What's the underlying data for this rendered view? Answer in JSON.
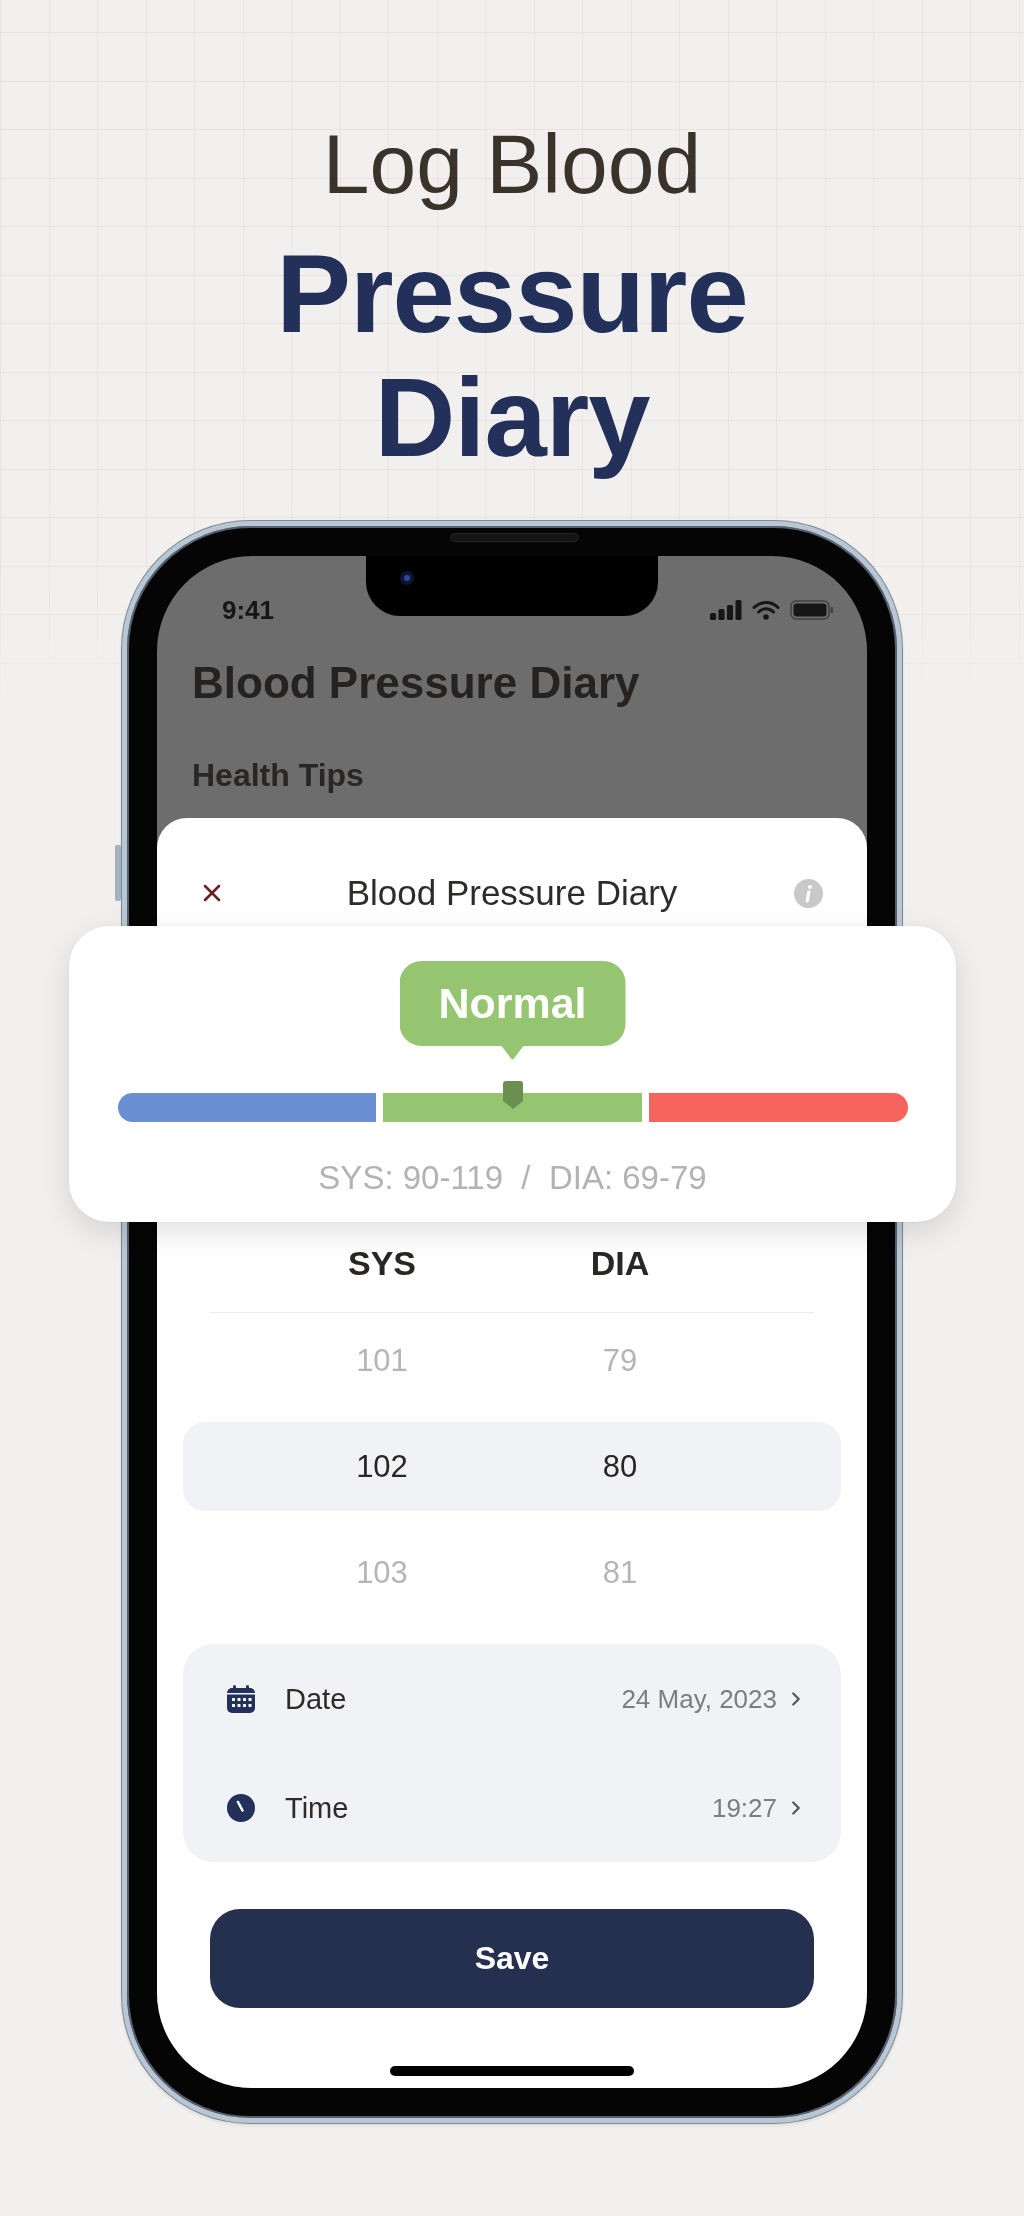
{
  "headline": {
    "lead": "Log Blood",
    "title": "Pressure Diary"
  },
  "status_bar": {
    "time": "9:41"
  },
  "background_screen": {
    "title": "Blood Pressure Diary",
    "section": "Health Tips"
  },
  "sheet": {
    "title": "Blood Pressure Diary",
    "category_card": {
      "label": "Normal",
      "level": 0.5,
      "segments": [
        {
          "color": "#6a8fd3"
        },
        {
          "color": "#95c571"
        },
        {
          "color": "#f7645e"
        }
      ],
      "range": "SYS: 90-119  /  DIA: 69-79"
    },
    "picker": {
      "columns": [
        "SYS",
        "DIA"
      ],
      "rows": [
        {
          "values": [
            "101",
            "79"
          ],
          "selected": false
        },
        {
          "values": [
            "102",
            "80"
          ],
          "selected": true
        },
        {
          "values": [
            "103",
            "81"
          ],
          "selected": false
        }
      ]
    },
    "details": [
      {
        "kind": "date",
        "label": "Date",
        "value": "24 May, 2023"
      },
      {
        "kind": "time",
        "label": "Time",
        "value": "19:27"
      }
    ],
    "save_button": "Save"
  }
}
